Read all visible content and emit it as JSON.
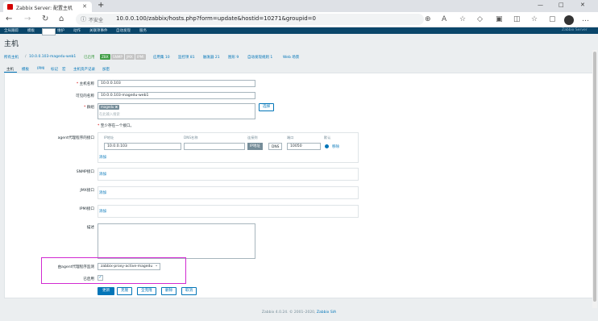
{
  "browser": {
    "tab_title": "Zabbix Server: 配置主机",
    "tab_close": "✕",
    "new_tab": "+",
    "window_min": "—",
    "window_max": "□",
    "window_close": "✕",
    "security_label": "不安全",
    "url": "10.0.0.100/zabbix/hosts.php?form=update&hostid=10271&groupid=0"
  },
  "menu": {
    "items": [
      "全局跟踪",
      "模板",
      "主机",
      "维护",
      "动作",
      "关联项事件",
      "自动发现",
      "服务"
    ],
    "active_index": 2,
    "right_text": "Zabbix Server"
  },
  "page_title": "主机",
  "breadcrumb": {
    "all_hosts": "所有主机",
    "separator": "/",
    "host": "10.0.0.103-magedu-web1",
    "enabled": "已启用",
    "badges": [
      {
        "text": "ZBX",
        "color": "#429e47"
      },
      {
        "text": "SNMP",
        "color": "#c3c3c3"
      },
      {
        "text": "JMX",
        "color": "#c3c3c3"
      },
      {
        "text": "IPMI",
        "color": "#c3c3c3"
      }
    ],
    "links": [
      "应用集 10",
      "监控项 81",
      "触发器 21",
      "图形 9",
      "自动发现规则 1",
      "Web 场景"
    ]
  },
  "subtabs": [
    "主机",
    "模板",
    "IPMI",
    "标记",
    "宏",
    "主机资产记录",
    "加密"
  ],
  "form": {
    "hostname_label": "主机名称",
    "hostname_value": "10.0.0.103",
    "visible_label": "可见的名称",
    "visible_value": "10.0.0.103-magedu-web1",
    "groups_label": "群组",
    "group_pill": "magedu",
    "group_pill_x": "✖",
    "groups_placeholder": "在此输入搜索",
    "select_button": "选择",
    "iface_note": "至少存在一个接口。",
    "agent_label": "agent代理程序的接口",
    "col_ip": "IP地址",
    "col_dns": "DNS名称",
    "col_connect": "连接到",
    "col_port": "端口",
    "col_default": "默认",
    "agent_ip": "10.0.0.103",
    "agent_dns": "",
    "connect_ip": "IP地址",
    "connect_dns": "DNS",
    "agent_port": "10050",
    "remove": "移除",
    "add": "添加",
    "snmp_label": "SNMP接口",
    "jmx_label": "JMX接口",
    "ipmi_label": "IPMI接口",
    "desc_label": "描述",
    "proxy_label": "由agent代理程序监测",
    "proxy_value": "zabbix-proxy-active-magedu",
    "enabled_label": "已启用",
    "check_mark": "✓"
  },
  "actions": [
    "更新",
    "克隆",
    "全克隆",
    "删除",
    "取消"
  ],
  "footer": {
    "text": "Zabbix 4.0.24. © 2001–2020,",
    "link": "Zabbix SIA"
  }
}
